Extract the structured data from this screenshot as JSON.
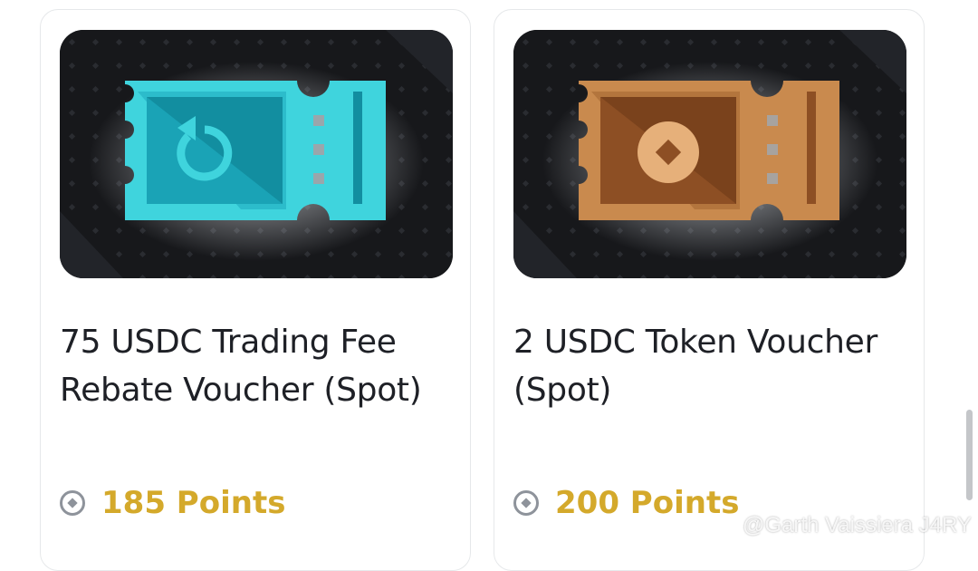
{
  "vouchers": [
    {
      "title": "75 USDC Trading Fee Rebate Voucher (Spot)",
      "points": "185 Points",
      "icon": "rebate-arrow-icon",
      "ticket_color": "#3fd4dd",
      "ticket_inner": "#1aa3b6"
    },
    {
      "title": "2 USDC Token Voucher (Spot)",
      "points": "200 Points",
      "icon": "coin-diamond-icon",
      "ticket_color": "#c98a4e",
      "ticket_inner": "#8d4f24"
    }
  ],
  "colors": {
    "points_gold": "#d4a92b",
    "card_border": "#e6e8ea",
    "thumb_bg": "#17181b"
  },
  "watermark": {
    "text": "@Garth Vaissiera J4RY",
    "icon": "binance-logo-icon"
  }
}
